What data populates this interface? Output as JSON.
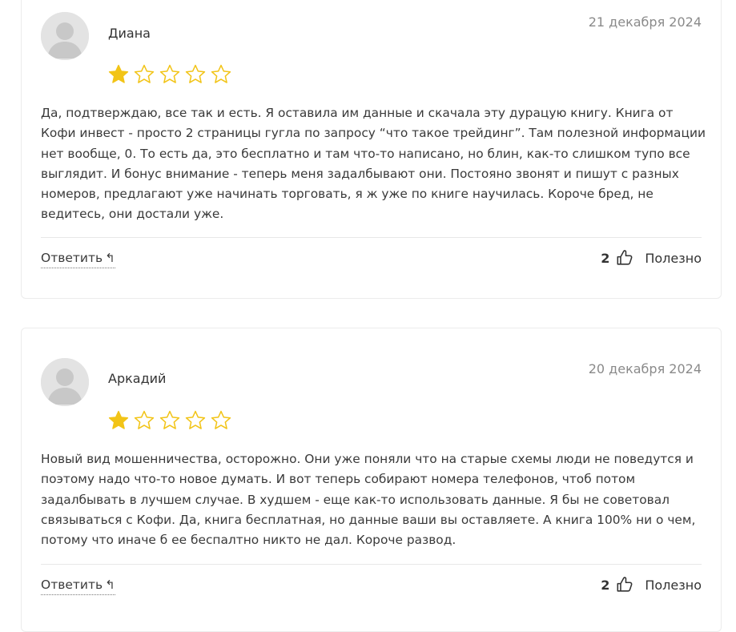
{
  "reviews": [
    {
      "author": "Диана",
      "date": "21 декабря 2024",
      "rating": 1,
      "max_rating": 5,
      "text": "Да, подтверждаю, все так и есть. Я оставила им данные и скачала эту дурацую книгу. Книга от Кофи инвест - просто 2 страницы гугла по запросу “что такое трейдинг”. Там полезной информации нет вообще, 0. То есть да, это бесплатно и там что-то написано, но блин, как-то слишком тупо все выглядит. И бонус внимание - теперь меня задалбывают они. Постояно звонят и пишут с разных номеров, предлагают уже начинать торговать, я ж уже по книге научилась. Короче бред, не ведитесь, они достали уже.",
      "reply_label": "Ответить",
      "likes": "2",
      "helpful_label": "Полезно"
    },
    {
      "author": "Аркадий",
      "date": "20 декабря 2024",
      "rating": 1,
      "max_rating": 5,
      "text": "Новый вид мошенничества, осторожно. Они уже поняли что на старые схемы люди не поведутся и поэтому надо что-то новое думать. И вот теперь собирают номера телефонов, чтоб потом задалбывать в лучшем случае. В худшем - еще как-то использовать данные. Я бы не советовал связываться с Кофи. Да, книга бесплатная, но данные ваши вы оставляете. А книга 100% ни о чем, потому что иначе б ее беспалтно никто не дал. Короче развод.",
      "reply_label": "Ответить",
      "likes": "2",
      "helpful_label": "Полезно"
    }
  ],
  "colors": {
    "star_filled": "#f2c417",
    "star_outline": "#f2c417",
    "avatar_bg": "#e3e3e3",
    "avatar_figure": "#c6c6c6"
  },
  "icons": {
    "avatar": "user-avatar-icon",
    "reply": "reply-arrow-icon",
    "like": "thumbs-up-icon"
  }
}
